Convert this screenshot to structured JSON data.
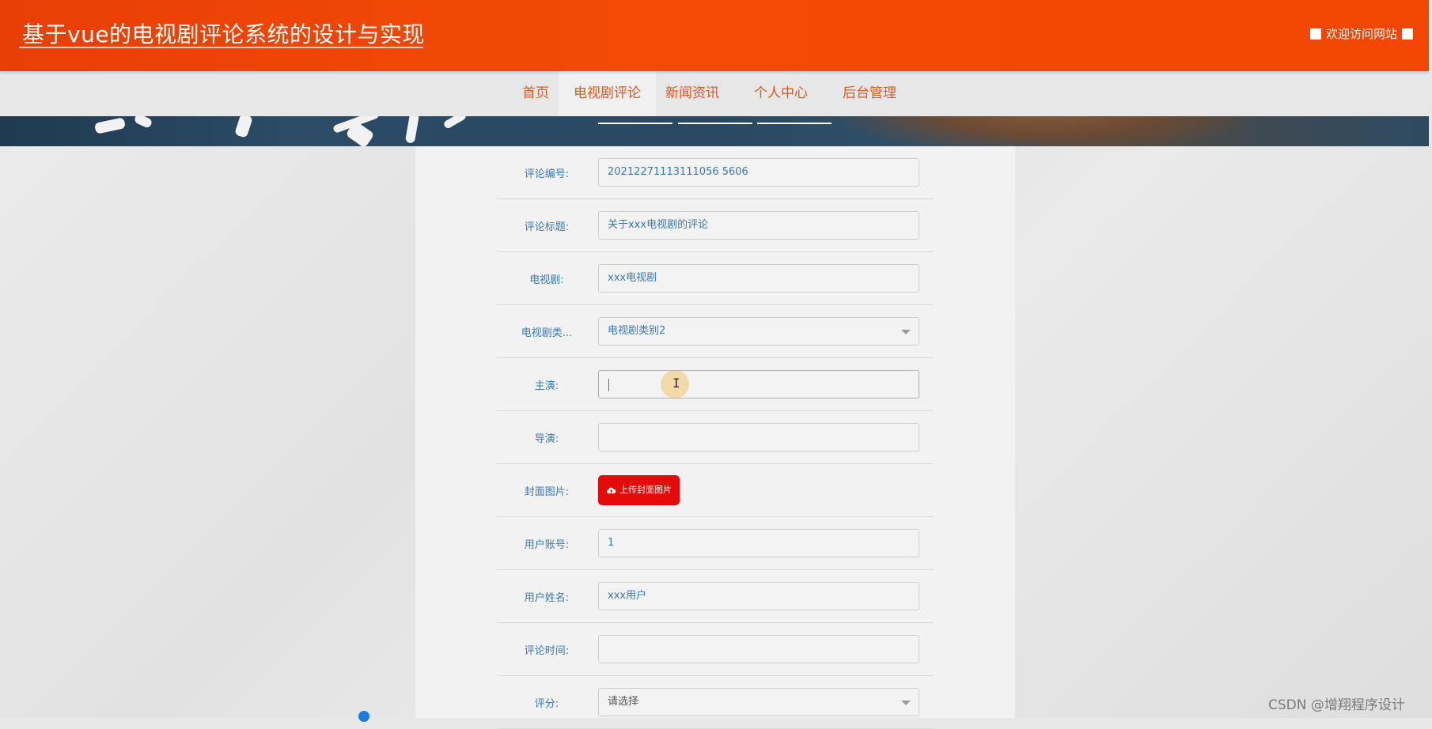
{
  "header": {
    "site_title": "基于vue的电视剧评论系统的设计与实现",
    "welcome_text": "欢迎访问网站"
  },
  "nav": {
    "items": [
      {
        "label": "首页",
        "active": false
      },
      {
        "label": "电视剧评论",
        "active": true
      },
      {
        "label": "新闻资讯",
        "active": false
      },
      {
        "label": "个人中心",
        "active": false
      },
      {
        "label": "后台管理",
        "active": false
      }
    ]
  },
  "form": {
    "comment_id": {
      "label": "评论编号:",
      "value": "20212271113111056 5606"
    },
    "comment_title": {
      "label": "评论标题:",
      "value": "关于xxx电视剧的评论"
    },
    "tv_show": {
      "label": "电视剧:",
      "value": "xxx电视剧"
    },
    "tv_category": {
      "label": "电视剧类...",
      "value": "电视剧类别2"
    },
    "lead_actor": {
      "label": "主演:",
      "value": ""
    },
    "director": {
      "label": "导演:",
      "value": ""
    },
    "cover_image": {
      "label": "封面图片:",
      "button_label": "上传封面图片"
    },
    "user_account": {
      "label": "用户账号:",
      "value": "1"
    },
    "user_name": {
      "label": "用户姓名:",
      "value": "xxx用户"
    },
    "comment_time": {
      "label": "评论时间:",
      "value": ""
    },
    "rating": {
      "label": "评分:",
      "placeholder": "请选择"
    }
  },
  "watermark": "CSDN @增翔程序设计",
  "colors": {
    "header_orange": "#f24703",
    "nav_text": "#e3571b",
    "label_blue": "#3a78b5",
    "upload_red": "#e50a0a"
  }
}
